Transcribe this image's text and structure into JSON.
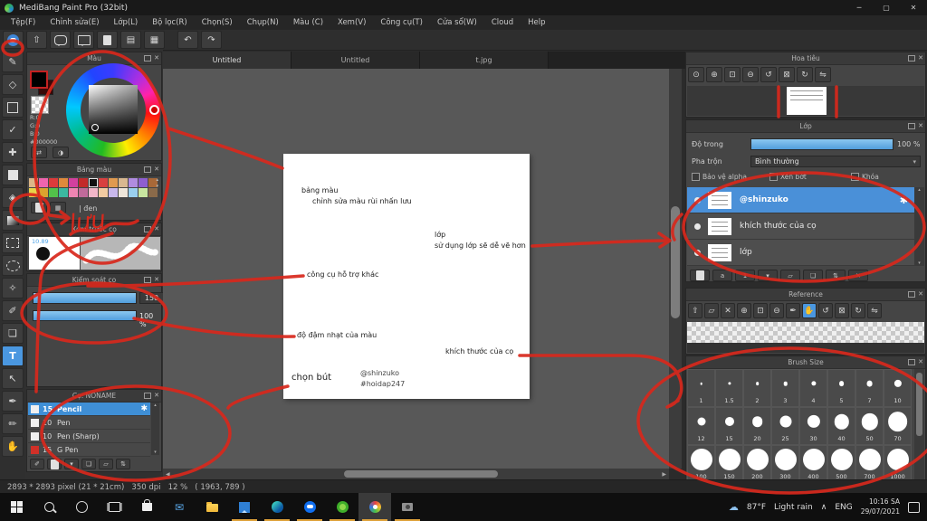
{
  "window": {
    "title": "MediBang Paint Pro (32bit)",
    "minimize": "─",
    "restore": "▢",
    "close": "✕"
  },
  "icons": {
    "close": "✕",
    "caret_down": "▾",
    "scroll_up": "▴",
    "scroll_down": "▾",
    "arrow_left": "◀",
    "arrow_right": "▶",
    "gear": "✱",
    "cloud": "☁"
  },
  "menu_items": [
    "Tệp(F)",
    "Chỉnh sửa(E)",
    "Lớp(L)",
    "Bộ lọc(R)",
    "Chọn(S)",
    "Chụp(N)",
    "Màu (C)",
    "Xem(V)",
    "Công cụ(T)",
    "Cửa sổ(W)",
    "Cloud",
    "Help"
  ],
  "toolbar_buttons": [
    {
      "name": "cloud-save-button",
      "type": "cloud"
    },
    {
      "name": "export-button",
      "glyph": "⇧"
    },
    {
      "name": "comment-button",
      "type": "bubble"
    },
    {
      "name": "message-button",
      "type": "bubble-square"
    },
    {
      "name": "document-button",
      "type": "doc"
    },
    {
      "name": "list-settings-button",
      "glyph": "▤"
    },
    {
      "name": "grid-settings-button",
      "glyph": "▦"
    },
    {
      "name": "separator",
      "type": "sep"
    },
    {
      "name": "undo-button",
      "glyph": "↶"
    },
    {
      "name": "redo-button",
      "glyph": "↷"
    }
  ],
  "tool_strip": [
    {
      "name": "pen-tool",
      "glyph": "✎"
    },
    {
      "name": "eraser-tool",
      "glyph": "◇"
    },
    {
      "name": "shape-brush-tool",
      "shape": "square-outline"
    },
    {
      "name": "polyline-tool",
      "glyph": "✓"
    },
    {
      "name": "move-tool",
      "glyph": "✚"
    },
    {
      "name": "select-tool",
      "shape": "square-filled"
    },
    {
      "name": "bucket-tool",
      "glyph": "◈"
    },
    {
      "name": "gradient-tool",
      "shape": "gradient"
    },
    {
      "name": "rect-select-tool",
      "shape": "dashed-rect"
    },
    {
      "name": "lasso-tool",
      "shape": "dashed-ellipse"
    },
    {
      "name": "magic-wand-tool",
      "glyph": "✧"
    },
    {
      "name": "select-pen-tool",
      "glyph": "✐"
    },
    {
      "name": "select-eraser-tool",
      "glyph": "❏"
    },
    {
      "name": "text-tool",
      "glyph": "T",
      "active": true
    },
    {
      "name": "operation-tool",
      "glyph": "↖"
    },
    {
      "name": "eyedropper-tool",
      "glyph": "✒"
    },
    {
      "name": "divide-tool",
      "glyph": "✏"
    },
    {
      "name": "hand-tool",
      "glyph": "✋"
    }
  ],
  "document_tabs": [
    {
      "label": "Untitled",
      "active": true
    },
    {
      "label": "Untitled",
      "active": false
    },
    {
      "label": "t.jpg",
      "active": false
    }
  ],
  "color_panel": {
    "title": "Màu",
    "r_label": "R:0",
    "g_label": "G:0",
    "b_label": "B:0",
    "hex_label": "#000000",
    "buttons": [
      {
        "name": "swap-color-button",
        "glyph": "⇄"
      },
      {
        "name": "color-mode-button",
        "glyph": "◑"
      }
    ]
  },
  "palette_panel": {
    "title": "Bảng màu",
    "selected_label": "| đen",
    "selected_index": 6,
    "swatches_row1": [
      "#dcb688",
      "#ef64ae",
      "#dd3b3b",
      "#e08a3c",
      "#d2409e",
      "#c22a2a",
      "#111111",
      "#d84040",
      "#e09a50",
      "#d8b890",
      "#b08ce0",
      "#8e5ed0",
      "#a86838"
    ],
    "swatches_row2": [
      "#e8d44a",
      "#dca32e",
      "#52c24a",
      "#3cb8a0",
      "#ee85b2",
      "#c06a9a",
      "#f2b6c8",
      "#f2cba2",
      "#c9b8ec",
      "#efe6da",
      "#9ad0ee",
      "#c8e6a0",
      "#8a6a4a"
    ],
    "buttons": [
      {
        "name": "new-color-button",
        "type": "doc"
      },
      {
        "name": "palette-grid-button",
        "glyph": "▦"
      }
    ]
  },
  "brush_preview_panel": {
    "title": "Xem trước cọ",
    "size_label": "10.89"
  },
  "brush_control_panel": {
    "title": "Kiểm soát cọ",
    "size_value": "150",
    "opacity_value": "100 %"
  },
  "brush_list_panel": {
    "title": "Cọ: NONAME",
    "brushes": [
      {
        "size": "15",
        "name": "Pencil",
        "selected": true,
        "chip": "#f0f0f0"
      },
      {
        "size": "10",
        "name": "Pen",
        "chip": "#f0f0f0"
      },
      {
        "size": "10",
        "name": "Pen (Sharp)",
        "chip": "#f0f0f0"
      },
      {
        "size": "15",
        "name": "G Pen",
        "chip": "#d03028"
      }
    ],
    "buttons": [
      {
        "name": "brush-pen-button",
        "glyph": "✐"
      },
      {
        "name": "new-brush-button",
        "type": "doc"
      },
      {
        "name": "brush-menu-button",
        "glyph": "▾"
      },
      {
        "name": "brush-script-button",
        "glyph": "❏"
      },
      {
        "name": "brush-folder-button",
        "glyph": "▱"
      },
      {
        "name": "duplicate-brush-button",
        "glyph": "⇅"
      }
    ]
  },
  "canvas_notes": {
    "note_palette_1": "bảng màu",
    "note_palette_2": "chỉnh sửa màu rùi nhấn lưu",
    "note_layer_1": "lớp",
    "note_layer_2": "sử dụng lớp sẽ dễ vẽ hơn",
    "note_tools": "công cụ hỗ trợ khác",
    "note_opacity": "độ đậm nhạt của màu",
    "note_brush_size": "khích thước của cọ",
    "note_pen": "chọn bút",
    "credit_1": "@shinzuko",
    "credit_2": "#hoidap247"
  },
  "navigator_panel": {
    "title": "Hoa tiêu",
    "buttons": [
      {
        "name": "zoom-actual-button",
        "glyph": "⊙"
      },
      {
        "name": "zoom-in-button",
        "glyph": "⊕"
      },
      {
        "name": "fit-window-button",
        "glyph": "⊡"
      },
      {
        "name": "zoom-out-button",
        "glyph": "⊖"
      },
      {
        "name": "rotate-ccw-button",
        "glyph": "↺"
      },
      {
        "name": "reset-rotation-button",
        "glyph": "⊠"
      },
      {
        "name": "rotate-cw-button",
        "glyph": "↻"
      },
      {
        "name": "flip-button",
        "glyph": "⇋"
      }
    ]
  },
  "layer_panel": {
    "title": "Lớp",
    "opacity_label": "Độ trong",
    "opacity_value": "100 %",
    "blend_label": "Pha trộn",
    "blend_value": "Bình thường",
    "checkboxes": [
      "Bảo vệ alpha",
      "Xén bớt",
      "Khóa"
    ],
    "layers": [
      {
        "name": "@shinzuko",
        "selected": true
      },
      {
        "name": "khích thước của cọ",
        "selected": false
      },
      {
        "name": "lớp",
        "selected": false
      }
    ],
    "buttons": [
      {
        "name": "new-layer-button",
        "type": "doc"
      },
      {
        "name": "new-8bit-layer-button",
        "glyph": "a"
      },
      {
        "name": "new-1bit-layer-button",
        "glyph": "1"
      },
      {
        "name": "layer-menu-button",
        "glyph": "▾"
      },
      {
        "name": "new-folder-button",
        "glyph": "▱"
      },
      {
        "name": "duplicate-layer-button",
        "glyph": "❏"
      },
      {
        "name": "transfer-layer-button",
        "glyph": "⇅"
      },
      {
        "name": "delete-layer-button",
        "glyph": "✕"
      }
    ]
  },
  "reference_panel": {
    "title": "Reference",
    "buttons": [
      {
        "name": "load-image-button",
        "glyph": "⇧"
      },
      {
        "name": "open-folder-button",
        "glyph": "▱"
      },
      {
        "name": "clear-button",
        "glyph": "✕"
      },
      {
        "name": "zoom-in-button",
        "glyph": "⊕"
      },
      {
        "name": "fit-button",
        "glyph": "⊡"
      },
      {
        "name": "zoom-out-button",
        "glyph": "⊖"
      },
      {
        "name": "eyedropper-button",
        "glyph": "✒"
      },
      {
        "name": "hand-button",
        "glyph": "✋",
        "active": true
      },
      {
        "name": "rotate-ccw-button",
        "glyph": "↺"
      },
      {
        "name": "reset-button",
        "glyph": "⊠"
      },
      {
        "name": "rotate-cw-button",
        "glyph": "↻"
      },
      {
        "name": "flip-button",
        "glyph": "⇋"
      }
    ]
  },
  "brush_size_panel": {
    "title": "Brush Size",
    "sizes": [
      "1",
      "1.5",
      "2",
      "3",
      "4",
      "5",
      "7",
      "10",
      "12",
      "15",
      "20",
      "25",
      "30",
      "40",
      "50",
      "70",
      "100",
      "150",
      "200",
      "300",
      "400",
      "500",
      "700",
      "1000"
    ]
  },
  "status_bar": {
    "text": "2893 * 2893 pixel (21 * 21cm)   350 dpi   12 %   ( 1963, 789 )"
  },
  "taskbar": {
    "icons": [
      {
        "name": "start-button",
        "type": "start"
      },
      {
        "name": "search-button",
        "type": "search"
      },
      {
        "name": "cortana-button",
        "type": "cortana"
      },
      {
        "name": "task-view-button",
        "type": "taskview"
      },
      {
        "name": "store-icon",
        "type": "store"
      },
      {
        "name": "mail-icon",
        "type": "mail"
      },
      {
        "name": "file-explorer-icon",
        "type": "folder"
      },
      {
        "name": "photos-icon",
        "type": "photos",
        "running": true
      },
      {
        "name": "edge-icon",
        "type": "edge",
        "running": true
      },
      {
        "name": "zalo-icon",
        "type": "zalo",
        "running": true
      },
      {
        "name": "coccoc-icon",
        "type": "coccoc",
        "running": true
      },
      {
        "name": "medibang-icon",
        "type": "medibang",
        "running": true,
        "active": true
      },
      {
        "name": "camera-icon",
        "type": "camera",
        "running": true
      }
    ],
    "weather_temp": "87°F",
    "weather_desc": "Light rain",
    "tray_caret": "∧",
    "language": "ENG",
    "time": "10:16 SA",
    "date": "29/07/2021"
  },
  "annotations": {
    "handwriting": "lưu"
  },
  "colors": {
    "accent_blue": "#4a90d8",
    "annotation_red": "#d8281c",
    "slider_blue": "#63a8e0"
  }
}
